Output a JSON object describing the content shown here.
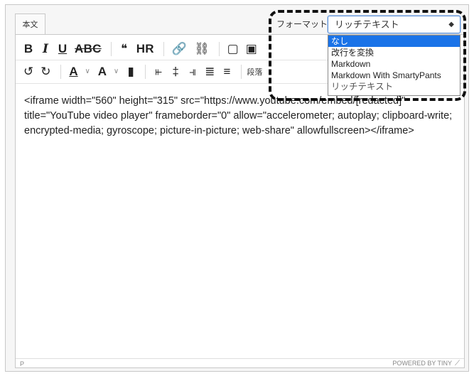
{
  "tab": {
    "label": "本文"
  },
  "toolbar": {
    "row1": [
      {
        "name": "bold-button",
        "glyph": "B",
        "cls": "b"
      },
      {
        "name": "italic-button",
        "glyph": "I",
        "cls": "i"
      },
      {
        "name": "underline-button",
        "glyph": "U",
        "cls": "u"
      },
      {
        "name": "strikethrough-button",
        "glyph": "ABC",
        "cls": "small strike"
      },
      {
        "name": "blockquote-button",
        "glyph": "❝",
        "cls": ""
      },
      {
        "name": "horizontal-rule-button",
        "glyph": "HR",
        "cls": "small"
      },
      {
        "name": "link-button",
        "glyph": "🔗",
        "cls": ""
      },
      {
        "name": "unlink-button",
        "glyph": "⛓",
        "cls": "disabled"
      },
      {
        "name": "source-code-button",
        "glyph": "▢",
        "cls": ""
      },
      {
        "name": "insert-image-button",
        "glyph": "▣",
        "cls": ""
      }
    ],
    "row2": [
      {
        "name": "undo-button",
        "glyph": "↺",
        "cls": ""
      },
      {
        "name": "redo-button",
        "glyph": "↻",
        "cls": "disabled"
      },
      {
        "name": "text-color-button",
        "glyph": "A",
        "cls": "u"
      },
      {
        "name": "background-color-button",
        "glyph": "A",
        "cls": "b"
      },
      {
        "name": "clear-format-button",
        "glyph": "▮",
        "cls": ""
      },
      {
        "name": "align-left-button",
        "glyph": "⫦",
        "cls": ""
      },
      {
        "name": "align-center-button",
        "glyph": "‡",
        "cls": ""
      },
      {
        "name": "align-right-button",
        "glyph": "⫣",
        "cls": ""
      },
      {
        "name": "indent-button",
        "glyph": "≣",
        "cls": ""
      },
      {
        "name": "outdent-button",
        "glyph": "≡",
        "cls": "disabled"
      }
    ],
    "paragraph_label": "段落"
  },
  "format": {
    "label": "フォーマット:",
    "selected": "リッチテキスト",
    "options": [
      "なし",
      "改行を変換",
      "Markdown",
      "Markdown With SmartyPants",
      "リッチテキスト"
    ]
  },
  "content": {
    "text": "<iframe width=\"560\" height=\"315\" src=\"https://www.youtube.com/embed/[redacted]\" title=\"YouTube video player\" frameborder=\"0\" allow=\"accelerometer; autoplay; clipboard-write; encrypted-media; gyroscope; picture-in-picture; web-share\" allowfullscreen></iframe>"
  },
  "status": {
    "path": "P",
    "branding": "POWERED BY TINY"
  }
}
